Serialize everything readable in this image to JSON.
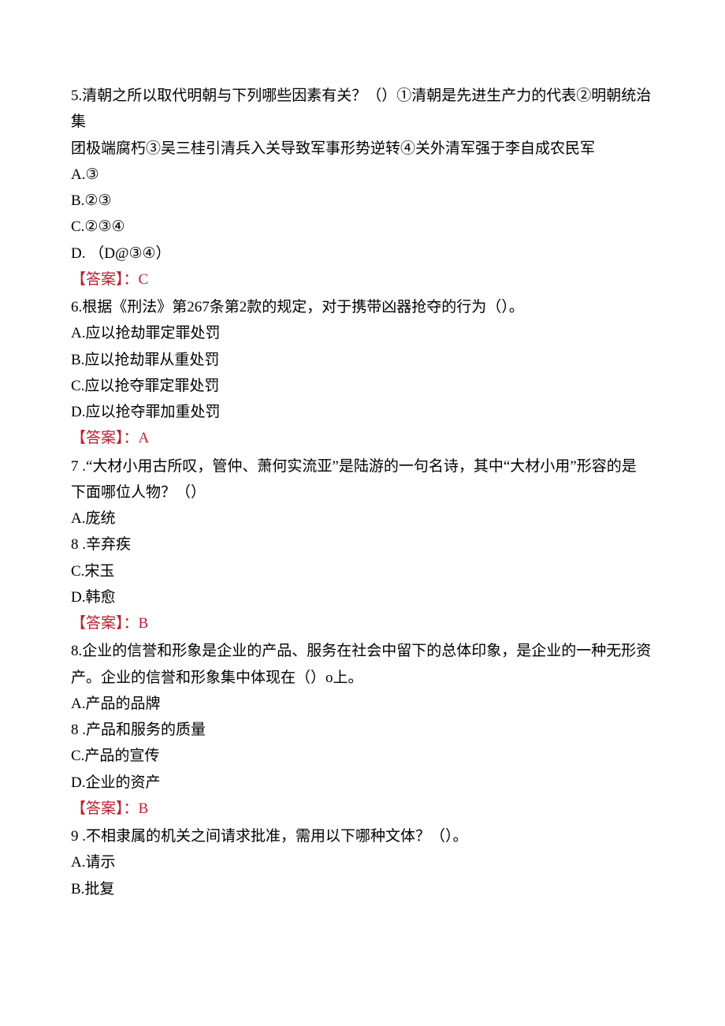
{
  "questions": [
    {
      "number_prefix": "5.",
      "text_line1": "5.清朝之所以取代明朝与下列哪些因素有关？（）①清朝是先进生产力的代表②明朝统治集",
      "text_line2": "团极端腐朽③吴三桂引清兵入关导致军事形势逆转④关外清军强于李自成农民军",
      "options": [
        "A.③",
        "B.②③",
        "C.②③④",
        "D. （D@③④）"
      ],
      "answer_label": "【答案】：",
      "answer_value": "C"
    },
    {
      "text_line1": "6.根据《刑法》第267条第2款的规定，对于携带凶器抢夺的行为（）。",
      "options": [
        "A.应以抢劫罪定罪处罚",
        "B.应以抢劫罪从重处罚",
        "C.应以抢夺罪定罪处罚",
        "D.应以抢夺罪加重处罚"
      ],
      "answer_label": "【答案】：",
      "answer_value": "A"
    },
    {
      "text_line1": "7 .“大材小用古所叹，管仲、萧何实流亚”是陆游的一句名诗，其中“大材小用”形容的是",
      "text_line2": "下面哪位人物？（）",
      "options": [
        "A.庞统",
        "8 .辛弃疾",
        "C.宋玉",
        "D.韩愈"
      ],
      "answer_label": "【答案】：",
      "answer_value": "B"
    },
    {
      "text_line1": "8.企业的信誉和形象是企业的产品、服务在社会中留下的总体印象，是企业的一种无形资",
      "text_line2": "产。企业的信誉和形象集中体现在（）o上。",
      "options": [
        "A.产品的品牌",
        "8 .产品和服务的质量",
        "C.产品的宣传",
        "D.企业的资产"
      ],
      "answer_label": "【答案】：",
      "answer_value": "B"
    },
    {
      "text_line1": "9 .不相隶属的机关之间请求批准，需用以下哪种文体？（）。",
      "options": [
        "A.请示",
        "B.批复"
      ]
    }
  ]
}
